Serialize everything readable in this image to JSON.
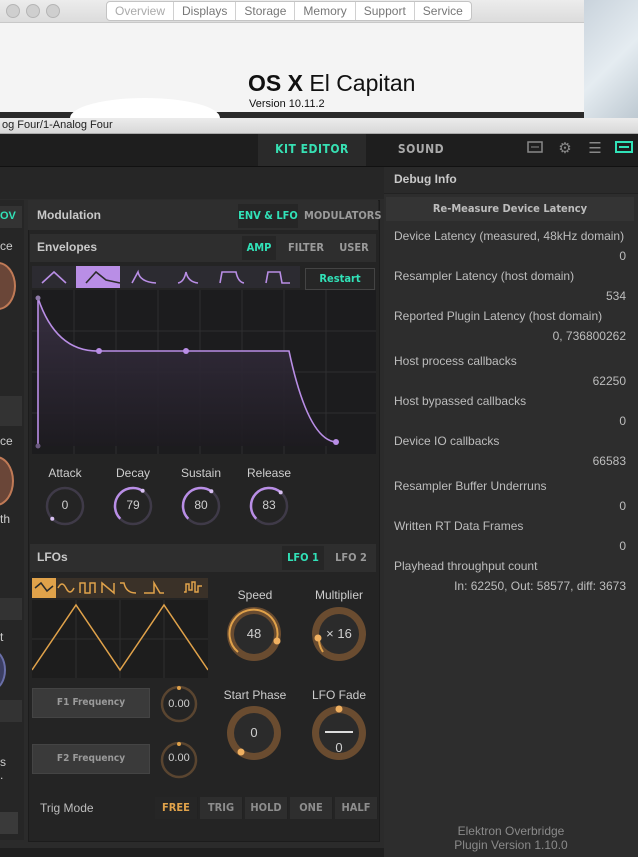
{
  "about": {
    "tabs": [
      "Overview",
      "Displays",
      "Storage",
      "Memory",
      "Support",
      "Service"
    ],
    "active_tab": "Overview",
    "os_name_bold": "OS X",
    "os_name_rest": "El Capitan",
    "version": "Version 10.11.2"
  },
  "plugin": {
    "title": "og Four/1-Analog Four",
    "nav": {
      "kit_editor": "KIT EDITOR",
      "sound_browser": "SOUND BROWSER"
    }
  },
  "left_fragments": [
    "OV",
    "ce",
    "ce",
    "th",
    "t",
    "s",
    "."
  ],
  "modulation": {
    "title": "Modulation",
    "tabs": [
      "ENV & LFO",
      "MODULATORS"
    ],
    "active_tab": "ENV & LFO"
  },
  "envelopes": {
    "title": "Envelopes",
    "tabs": [
      "AMP",
      "FILTER",
      "USER"
    ],
    "active_tab": "AMP",
    "restart_label": "Restart",
    "knobs": [
      {
        "label": "Attack",
        "value": "0",
        "level": 0.0
      },
      {
        "label": "Decay",
        "value": "79",
        "level": 0.62
      },
      {
        "label": "Sustain",
        "value": "80",
        "level": 0.63
      },
      {
        "label": "Release",
        "value": "83",
        "level": 0.65
      }
    ]
  },
  "lfos": {
    "title": "LFOs",
    "tabs": [
      "LFO 1",
      "LFO 2"
    ],
    "active_tab": "LFO 1",
    "speed": {
      "label": "Speed",
      "value": "48"
    },
    "multiplier": {
      "label": "Multiplier",
      "value": "× 16"
    },
    "start_phase": {
      "label": "Start Phase",
      "value": "0"
    },
    "lfo_fade": {
      "label": "LFO Fade",
      "value": "0"
    },
    "f1": {
      "label": "F1 Frequency",
      "value": "0.00"
    },
    "f2": {
      "label": "F2 Frequency",
      "value": "0.00"
    },
    "trig_mode_label": "Trig Mode",
    "trig_modes": [
      "FREE",
      "TRIG",
      "HOLD",
      "ONE",
      "HALF"
    ],
    "active_trig": "FREE"
  },
  "debug": {
    "title": "Debug Info",
    "remeasure_label": "Re-Measure Device Latency",
    "rows": [
      {
        "key": "Device Latency (measured, 48kHz domain)",
        "value": "0"
      },
      {
        "key": "Resampler Latency (host domain)",
        "value": "534"
      },
      {
        "key": "Reported Plugin Latency (host domain)",
        "value": "0, 736800262"
      },
      {
        "key": "Host process callbacks",
        "value": "62250"
      },
      {
        "key": "Host bypassed callbacks",
        "value": "0"
      },
      {
        "key": "Device IO callbacks",
        "value": "66583"
      },
      {
        "key": "Resampler Buffer Underruns",
        "value": "0"
      },
      {
        "key": "Written RT Data Frames",
        "value": "0"
      },
      {
        "key": "Playhead throughput count",
        "value": "In: 62250, Out: 58577, diff: 3673"
      }
    ],
    "footer_line1": "Elektron Overbridge",
    "footer_line2": "Plugin Version 1.10.0"
  },
  "colors": {
    "accent": "#31e2b8",
    "envelope": "#b98ee6",
    "lfo": "#e0a24a"
  }
}
